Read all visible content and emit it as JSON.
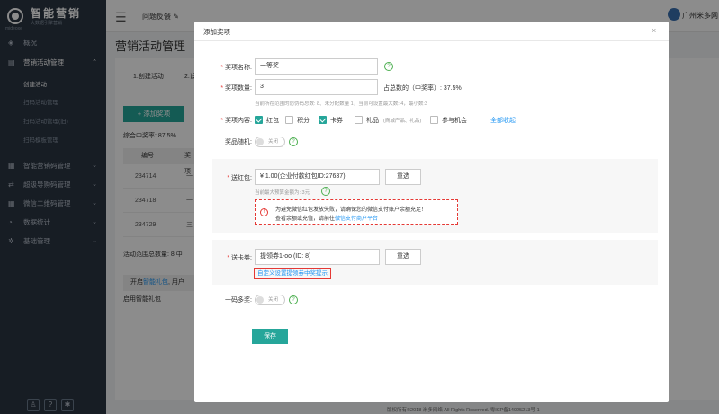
{
  "brand": {
    "name": "智能营销",
    "sub": "大数据引擎营销",
    "en": "mideoxe"
  },
  "topbar": {
    "feedback": "问题反馈",
    "org": "广州米多网"
  },
  "sidebar": {
    "items": [
      {
        "label": "概况",
        "icon": "layers-icon"
      },
      {
        "label": "营销活动管理",
        "icon": "chart-icon"
      },
      {
        "label": "智能营销码管理",
        "icon": "qrcode-icon"
      },
      {
        "label": "超级导购码管理",
        "icon": "shuffle-icon"
      },
      {
        "label": "微信二维码管理",
        "icon": "qrcode-icon"
      },
      {
        "label": "数据统计",
        "icon": "pie-icon"
      },
      {
        "label": "基础管理",
        "icon": "gear-icon"
      }
    ],
    "sub_items": [
      "创建活动",
      "扫码活动管理",
      "扫码活动管理(旧)",
      "扫码模板管理"
    ]
  },
  "background": {
    "page_title": "营销活动管理",
    "tabs": [
      "1.创建活动",
      "2.设"
    ],
    "add_prize": "+ 添加奖项",
    "win_rate": "综合中奖率: 87.5%",
    "table_head": [
      "编号",
      "奖项"
    ],
    "rows": [
      "234714",
      "234718",
      "234729"
    ],
    "row_snippets": [
      "一",
      "一",
      "三"
    ],
    "total": "活动范围总数量: 8",
    "total_extra": "中",
    "smart_text": "开启",
    "smart_link": "智能礼包",
    "smart_tail": ", 用户",
    "smart2": "启用智能礼包",
    "footer": "版权所有©2018 米多网络 All Rights Reserved. 粤ICP备14025213号-1"
  },
  "modal": {
    "title": "添加奖项",
    "fields": {
      "name_label": "奖项名称:",
      "name_value": "一等奖",
      "qty_label": "奖项数量:",
      "qty_value": "3",
      "qty_ratio": "占总数的（中奖率）: 37.5%",
      "qty_hint": "当前所在范围的防伪码总数: 8、未分配数量 1，当前可设置最大数: 4，最小数:3",
      "content_label": "奖项内容:",
      "options": [
        {
          "label": "红包",
          "checked": true
        },
        {
          "label": "积分",
          "checked": false
        },
        {
          "label": "卡券",
          "checked": true
        },
        {
          "label": "礼品",
          "checked": false,
          "note": "(商城产品、礼品)"
        },
        {
          "label": "参与机会",
          "checked": false
        }
      ],
      "collapse_all": "全部收起",
      "random_label": "奖品随机:",
      "toggle_off": "关闭",
      "redpack_label": "送红包:",
      "redpack_value": "¥ 1.00(企业付款红包ID:27637)",
      "reselect": "重选",
      "budget_hint": "当前最大预算金额为: 3元",
      "warn_line1": "为避免微信红包发放失败，请确保您的微信支付账户余额充足！",
      "warn_line2_pre": "查看余额或充值，请前往",
      "warn_link": "微信支付商户平台",
      "coupon_label": "送卡券:",
      "coupon_value": "提领券1-oo  (ID: 8)",
      "coupon_link": "自定义设置提领券中奖提示",
      "multi_label": "一码多奖:",
      "save": "保存"
    }
  },
  "colors": {
    "accent": "#26a69a",
    "sidebar": "#2b3643",
    "link": "#2196f3",
    "danger": "#e53935"
  }
}
